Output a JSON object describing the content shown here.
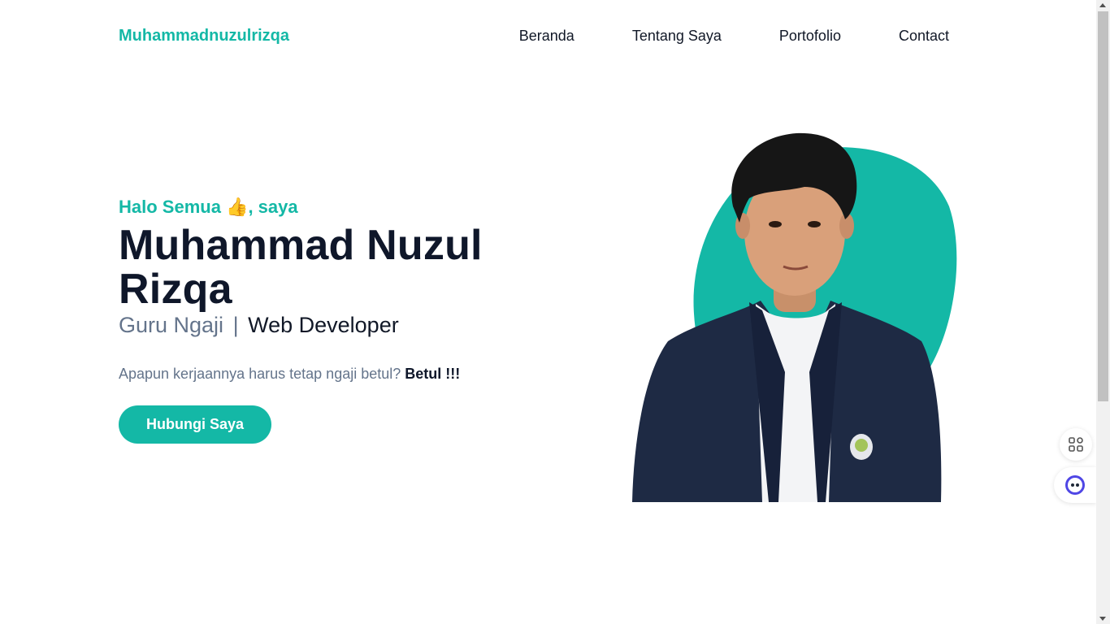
{
  "header": {
    "brand": "Muhammadnuzulrizqa",
    "nav": [
      {
        "label": "Beranda"
      },
      {
        "label": "Tentang Saya"
      },
      {
        "label": "Portofolio"
      },
      {
        "label": "Contact"
      }
    ]
  },
  "hero": {
    "greeting_before": "Halo Semua ",
    "greeting_emoji": "👍",
    "greeting_after": ", saya",
    "name_line1": "Muhammad Nuzul",
    "name_line2": "Rizqa",
    "role_primary": "Guru Ngaji",
    "role_separator": "|",
    "role_secondary": "Web Developer",
    "tagline_prefix": "Apapun kerjaannya harus tetap ngaji betul?",
    "tagline_emphasis": "Betul !!!",
    "cta_label": "Hubungi Saya"
  },
  "colors": {
    "accent": "#14b8a6",
    "heading": "#0f172a",
    "muted": "#64748b",
    "blazer": "#1e2a44"
  },
  "icons": {
    "floating_apps": "grid-icon",
    "floating_assistant": "assistant-face-icon"
  }
}
